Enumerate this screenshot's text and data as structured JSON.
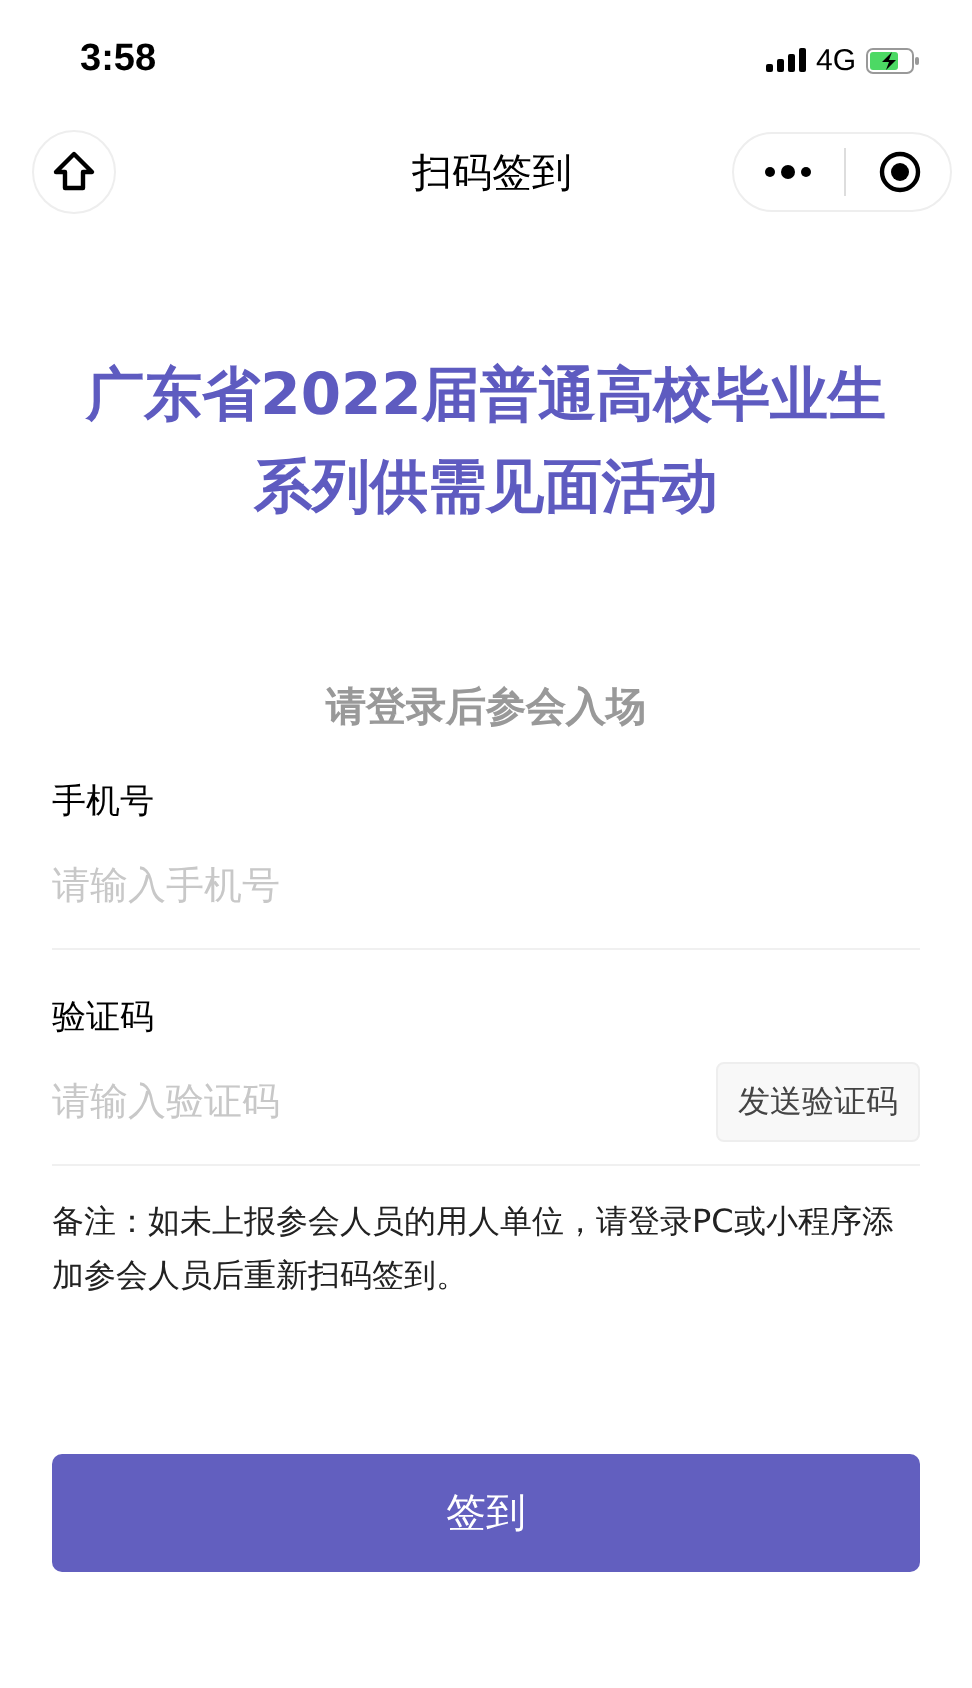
{
  "status_bar": {
    "time": "3:58",
    "network": "4G"
  },
  "nav_bar": {
    "title": "扫码签到"
  },
  "headline": [
    "广东省2022届普通高校毕业生",
    "系列供需见面活动"
  ],
  "subtitle": "请登录后参会入场",
  "fields": [
    {
      "label": "手机号",
      "placeholder": "请输入手机号"
    },
    {
      "label": "验证码",
      "placeholder": "请输入验证码",
      "button": "发送验证码"
    }
  ],
  "note": "备注：如未上报参会人员的用人单位，请登录PC或小程序添加参会人员后重新扫码签到。",
  "submit": "签到"
}
